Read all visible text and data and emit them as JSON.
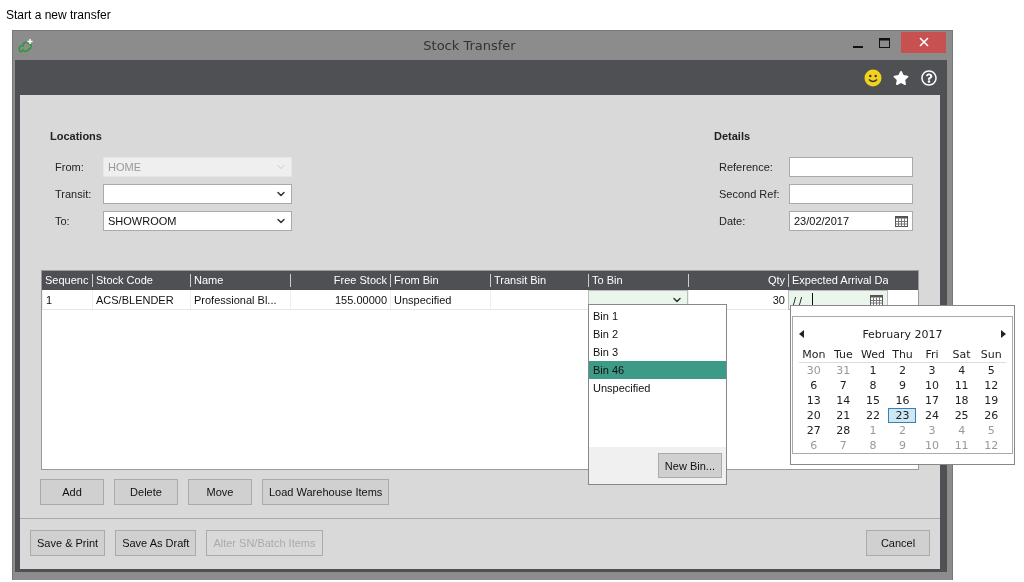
{
  "caption": "Start a new transfer",
  "window": {
    "title": "Stock Transfer"
  },
  "locations": {
    "heading": "Locations",
    "fields": [
      {
        "label": "From:",
        "value": "HOME",
        "disabled": true
      },
      {
        "label": "Transit:",
        "disabled": false
      },
      {
        "label": "To:",
        "value": "SHOWROOM",
        "disabled": false
      }
    ]
  },
  "details": {
    "heading": "Details",
    "fields": [
      {
        "label": "Reference:",
        "kind": "text"
      },
      {
        "label": "Second Ref:",
        "kind": "text"
      },
      {
        "label": "Date:",
        "value": "23/02/2017",
        "kind": "date"
      }
    ]
  },
  "grid": {
    "columns": [
      {
        "label": "Sequenc"
      },
      {
        "label": "Stock Code"
      },
      {
        "label": "Name"
      },
      {
        "label": "Free Stock"
      },
      {
        "label": "From Bin"
      },
      {
        "label": "Transit Bin"
      },
      {
        "label": "To Bin"
      },
      {
        "label": "Qty"
      },
      {
        "label": "Expected Arrival Da"
      }
    ],
    "rows": [
      {
        "cells": [
          {
            "kind": "text",
            "text": "1"
          },
          {
            "kind": "text",
            "text": "ACS/BLENDER"
          },
          {
            "kind": "text",
            "text": "Professional Bl..."
          },
          {
            "kind": "text",
            "text": "155.00000"
          },
          {
            "kind": "text",
            "text": "Unspecified"
          },
          {
            "kind": "text"
          },
          {
            "kind": "combo"
          },
          {
            "kind": "text",
            "text": "30"
          },
          {
            "kind": "date",
            "text": "/ /"
          }
        ]
      }
    ]
  },
  "grid_buttons": [
    "Add",
    "Delete",
    "Move",
    "Load Warehouse Items"
  ],
  "bin_dropdown": {
    "items": [
      {
        "label": "Bin 1",
        "selected": false
      },
      {
        "label": "Bin 2",
        "selected": false
      },
      {
        "label": "Bin 3",
        "selected": false
      },
      {
        "label": "Bin 46",
        "selected": true
      },
      {
        "label": "Unspecified",
        "selected": false
      }
    ],
    "button": "New Bin..."
  },
  "calendar": {
    "month": "February 2017",
    "weekdays": [
      "Mon",
      "Tue",
      "Wed",
      "Thu",
      "Fri",
      "Sat",
      "Sun"
    ],
    "weeks": [
      [
        {
          "day": "30",
          "other_month": true,
          "selected": false
        },
        {
          "day": "31",
          "other_month": true,
          "selected": false
        },
        {
          "day": "1",
          "other_month": false,
          "selected": false
        },
        {
          "day": "2",
          "other_month": false,
          "selected": false
        },
        {
          "day": "3",
          "other_month": false,
          "selected": false
        },
        {
          "day": "4",
          "other_month": false,
          "selected": false
        },
        {
          "day": "5",
          "other_month": false,
          "selected": false
        }
      ],
      [
        {
          "day": "6",
          "other_month": false,
          "selected": false
        },
        {
          "day": "7",
          "other_month": false,
          "selected": false
        },
        {
          "day": "8",
          "other_month": false,
          "selected": false
        },
        {
          "day": "9",
          "other_month": false,
          "selected": false
        },
        {
          "day": "10",
          "other_month": false,
          "selected": false
        },
        {
          "day": "11",
          "other_month": false,
          "selected": false
        },
        {
          "day": "12",
          "other_month": false,
          "selected": false
        }
      ],
      [
        {
          "day": "13",
          "other_month": false,
          "selected": false
        },
        {
          "day": "14",
          "other_month": false,
          "selected": false
        },
        {
          "day": "15",
          "other_month": false,
          "selected": false
        },
        {
          "day": "16",
          "other_month": false,
          "selected": false
        },
        {
          "day": "17",
          "other_month": false,
          "selected": false
        },
        {
          "day": "18",
          "other_month": false,
          "selected": false
        },
        {
          "day": "19",
          "other_month": false,
          "selected": false
        }
      ],
      [
        {
          "day": "20",
          "other_month": false,
          "selected": false
        },
        {
          "day": "21",
          "other_month": false,
          "selected": false
        },
        {
          "day": "22",
          "other_month": false,
          "selected": false
        },
        {
          "day": "23",
          "other_month": false,
          "selected": true
        },
        {
          "day": "24",
          "other_month": false,
          "selected": false
        },
        {
          "day": "25",
          "other_month": false,
          "selected": false
        },
        {
          "day": "26",
          "other_month": false,
          "selected": false
        }
      ],
      [
        {
          "day": "27",
          "other_month": false,
          "selected": false
        },
        {
          "day": "28",
          "other_month": false,
          "selected": false
        },
        {
          "day": "1",
          "other_month": true,
          "selected": false
        },
        {
          "day": "2",
          "other_month": true,
          "selected": false
        },
        {
          "day": "3",
          "other_month": true,
          "selected": false
        },
        {
          "day": "4",
          "other_month": true,
          "selected": false
        },
        {
          "day": "5",
          "other_month": true,
          "selected": false
        }
      ],
      [
        {
          "day": "6",
          "other_month": true,
          "selected": false
        },
        {
          "day": "7",
          "other_month": true,
          "selected": false
        },
        {
          "day": "8",
          "other_month": true,
          "selected": false
        },
        {
          "day": "9",
          "other_month": true,
          "selected": false
        },
        {
          "day": "10",
          "other_month": true,
          "selected": false
        },
        {
          "day": "11",
          "other_month": true,
          "selected": false
        },
        {
          "day": "12",
          "other_month": true,
          "selected": false
        }
      ]
    ]
  },
  "footer_buttons": [
    {
      "label": "Save & Print",
      "disabled": false
    },
    {
      "label": "Save As Draft",
      "disabled": false
    },
    {
      "label": "Alter SN/Batch Items",
      "disabled": true
    },
    {
      "label": "Cancel",
      "disabled": false
    }
  ]
}
